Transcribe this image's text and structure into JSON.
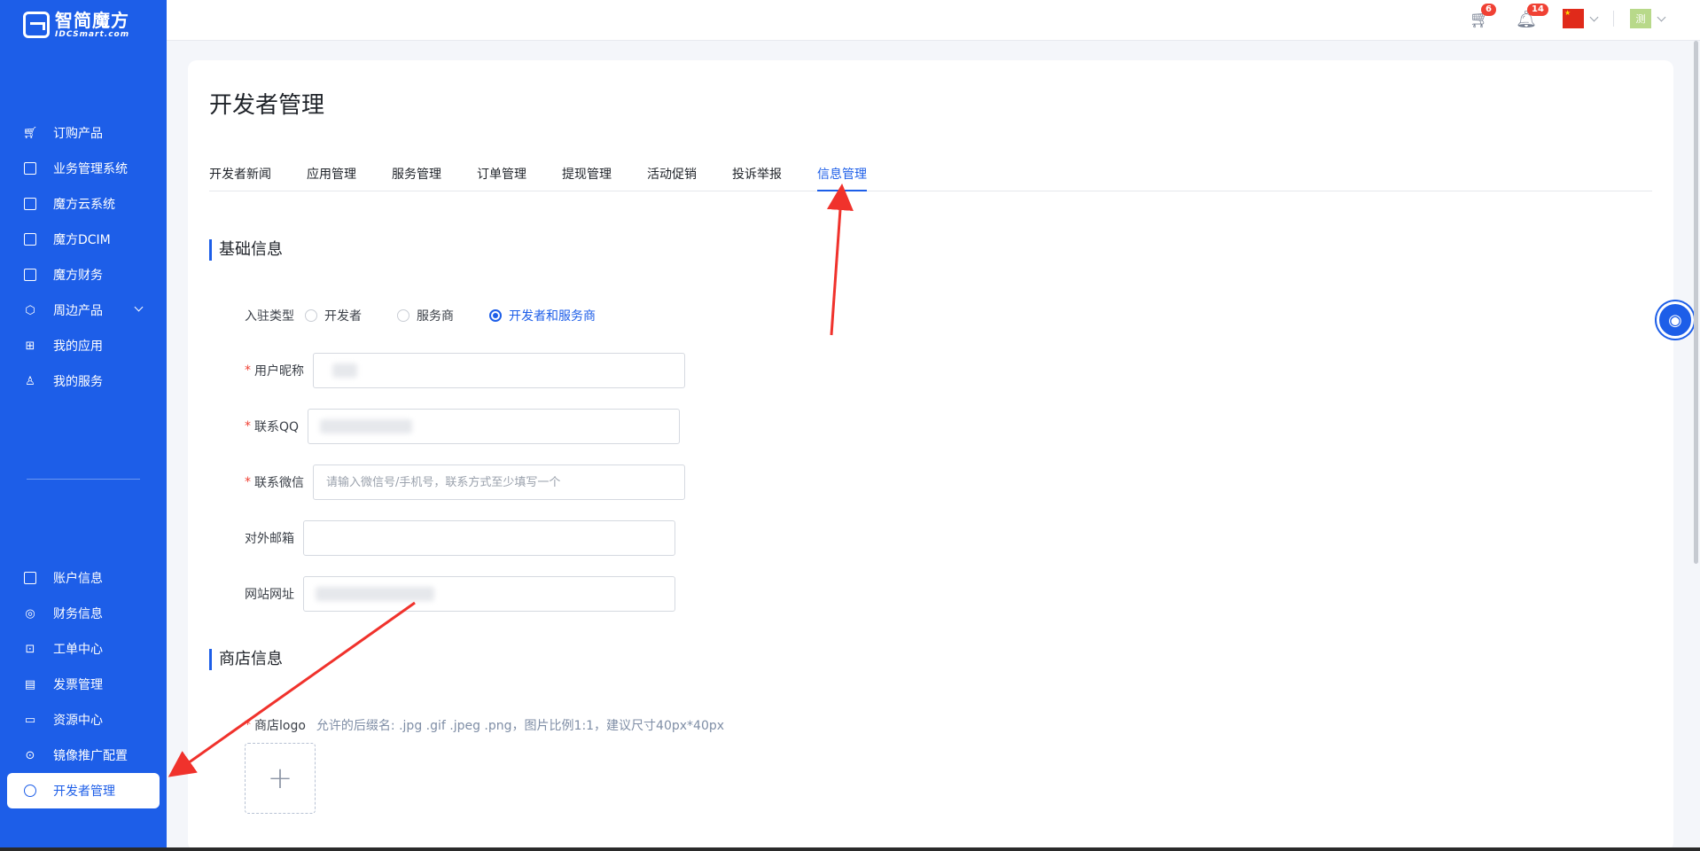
{
  "brand": {
    "name_cn": "智简魔方",
    "name_en": "IDCSmart.com"
  },
  "sidebar": {
    "top_items": [
      {
        "label": "订购产品",
        "icon": "cart-icon"
      },
      {
        "label": "业务管理系统",
        "icon": "brand-icon"
      },
      {
        "label": "魔方云系统",
        "icon": "brand-icon"
      },
      {
        "label": "魔方DCIM",
        "icon": "brand-icon"
      },
      {
        "label": "魔方财务",
        "icon": "brand-icon"
      },
      {
        "label": "周边产品",
        "icon": "cube-icon"
      },
      {
        "label": "我的应用",
        "icon": "apps-icon"
      },
      {
        "label": "我的服务",
        "icon": "user-icon"
      }
    ],
    "bottom_items": [
      {
        "label": "账户信息",
        "icon": "account-icon"
      },
      {
        "label": "财务信息",
        "icon": "finance-icon"
      },
      {
        "label": "工单中心",
        "icon": "ticket-icon"
      },
      {
        "label": "发票管理",
        "icon": "invoice-icon"
      },
      {
        "label": "资源中心",
        "icon": "folder-icon"
      },
      {
        "label": "镜像推广配置",
        "icon": "mirror-icon"
      },
      {
        "label": "开发者管理",
        "icon": "developer-icon"
      }
    ]
  },
  "topbar": {
    "cart_badge": "6",
    "bell_badge": "14",
    "avatar_text": "测"
  },
  "page": {
    "title": "开发者管理",
    "tabs": [
      "开发者新闻",
      "应用管理",
      "服务管理",
      "订单管理",
      "提现管理",
      "活动促销",
      "投诉举报",
      "信息管理"
    ],
    "active_tab": "信息管理"
  },
  "basic": {
    "section_title": "基础信息",
    "type_label": "入驻类型",
    "type_options": [
      "开发者",
      "服务商",
      "开发者和服务商"
    ],
    "type_selected": "开发者和服务商",
    "nickname_label": "用户昵称",
    "qq_label": "联系QQ",
    "wechat_label": "联系微信",
    "wechat_placeholder": "请输入微信号/手机号，联系方式至少填写一个",
    "email_label": "对外邮箱",
    "website_label": "网站网址"
  },
  "store": {
    "section_title": "商店信息",
    "logo_label": "商店logo",
    "logo_hint": "允许的后缀名: .jpg .gif .jpeg .png，图片比例1:1，建议尺寸40px*40px"
  },
  "colors": {
    "primary": "#1d5ee8",
    "annotation": "#f0322c",
    "required": "#f04134"
  }
}
